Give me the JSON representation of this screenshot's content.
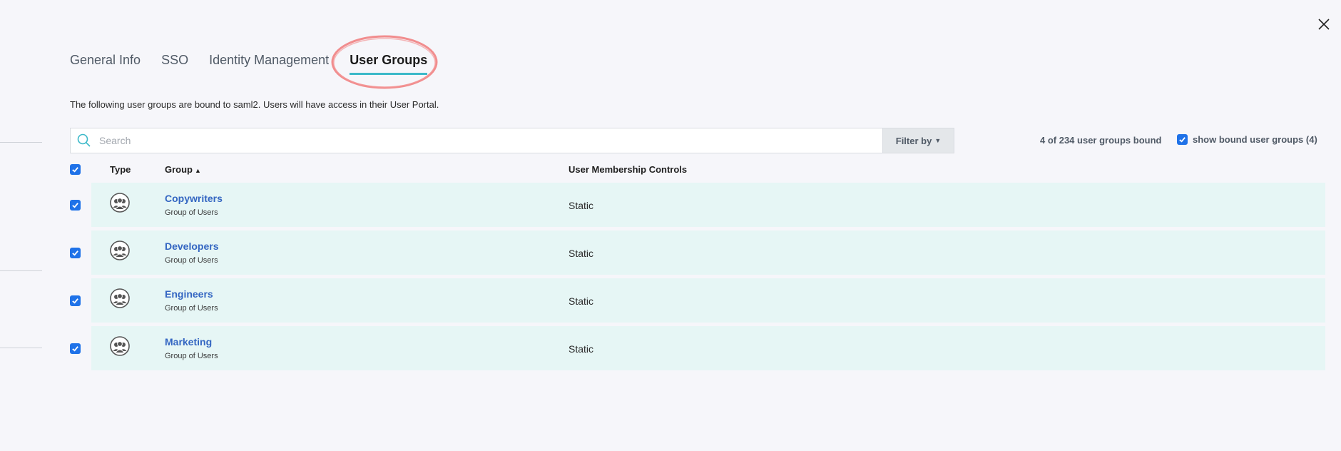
{
  "tabs": [
    {
      "label": "General Info",
      "active": false
    },
    {
      "label": "SSO",
      "active": false
    },
    {
      "label": "Identity Management",
      "active": false
    },
    {
      "label": "User Groups",
      "active": true
    }
  ],
  "description": "The following user groups are bound to saml2. Users will have access in their User Portal.",
  "search": {
    "placeholder": "Search",
    "value": ""
  },
  "filter": {
    "label": "Filter by"
  },
  "bound_count": "4 of 234 user groups bound",
  "show_bound": {
    "label": "show bound user groups (4)",
    "checked": true
  },
  "table": {
    "columns": {
      "type": "Type",
      "group": "Group",
      "membership": "User Membership Controls"
    },
    "rows": [
      {
        "name": "Copywriters",
        "kind": "Group of Users",
        "membership": "Static",
        "checked": true,
        "icon": "group-icon"
      },
      {
        "name": "Developers",
        "kind": "Group of Users",
        "membership": "Static",
        "checked": true,
        "icon": "group-icon"
      },
      {
        "name": "Engineers",
        "kind": "Group of Users",
        "membership": "Static",
        "checked": true,
        "icon": "group-icon"
      },
      {
        "name": "Marketing",
        "kind": "Group of Users",
        "membership": "Static",
        "checked": true,
        "icon": "group-icon"
      }
    ]
  },
  "colors": {
    "accent": "#3cb9c9",
    "checkbox": "#1f72e8",
    "link": "#3466c2",
    "row_bg": "#e6f6f5",
    "annotation": "#f07a7a"
  }
}
